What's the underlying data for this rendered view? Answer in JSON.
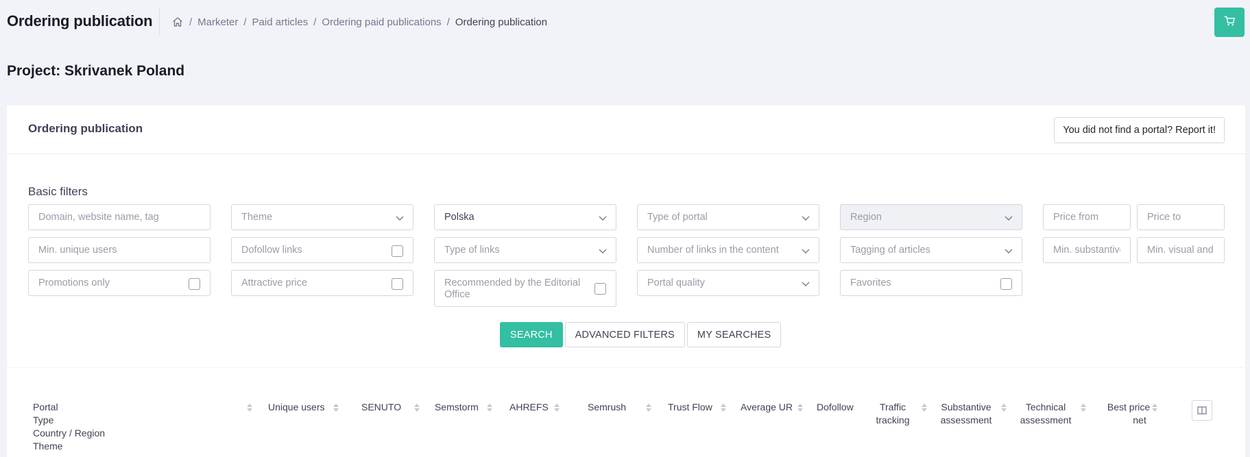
{
  "header": {
    "title": "Ordering publication",
    "breadcrumb": [
      "Marketer",
      "Paid articles",
      "Ordering paid publications",
      "Ordering publication"
    ],
    "breadcrumb_separator": "/"
  },
  "project": {
    "title": "Project: Skrivanek Poland"
  },
  "card": {
    "title": "Ordering publication",
    "report_button": "You did not find a portal? Report it!"
  },
  "filters": {
    "label": "Basic filters",
    "domain_placeholder": "Domain, website name, tag",
    "theme": "Theme",
    "country": "Polska",
    "type_of_portal": "Type of portal",
    "region": "Region",
    "price_from_placeholder": "Price from",
    "price_to_placeholder": "Price to",
    "min_unique_users_placeholder": "Min. unique users",
    "dofollow_links": "Dofollow links",
    "type_of_links": "Type of links",
    "number_of_links": "Number of links in the content",
    "tagging_of_articles": "Tagging of articles",
    "min_substantive_placeholder": "Min. substantive",
    "min_visual_placeholder": "Min. visual and",
    "promotions_only": "Promotions only",
    "attractive_price": "Attractive price",
    "recommended": "Recommended by the Editorial Office",
    "portal_quality": "Portal quality",
    "favorites": "Favorites"
  },
  "buttons": {
    "search": "SEARCH",
    "advanced_filters": "ADVANCED FILTERS",
    "my_searches": "MY SEARCHES"
  },
  "table": {
    "columns": {
      "portal": [
        "Portal",
        "Type",
        "Country / Region",
        "Theme"
      ],
      "unique_users": "Unique users",
      "senuto": "SENUTO",
      "semstorm": "Semstorm",
      "ahrefs": "AHREFS",
      "semrush": "Semrush",
      "trust_flow": "Trust Flow",
      "average_ur": "Average UR",
      "dofollow": "Dofollow",
      "traffic_tracking": [
        "Traffic",
        "tracking"
      ],
      "substantive_assessment": [
        "Substantive",
        "assessment"
      ],
      "technical_assessment": [
        "Technical",
        "assessment"
      ],
      "best_price": [
        "Best price",
        "net"
      ]
    }
  },
  "colors": {
    "accent": "#34bfa3",
    "background": "#f2f3f8"
  },
  "icons": {
    "home": "home-icon",
    "cart": "cart-icon",
    "chevron": "chevron-down-icon",
    "columns": "columns-icon"
  }
}
